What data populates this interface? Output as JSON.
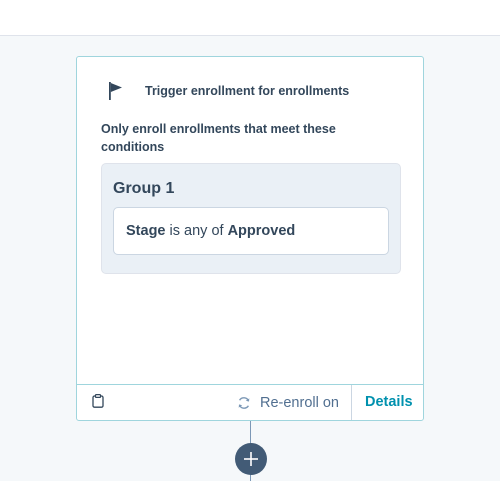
{
  "trigger_card": {
    "title": "Trigger enrollment for enrollments",
    "conditions_text": "Only enroll enrollments that meet these conditions",
    "group": {
      "title": "Group 1",
      "filter": {
        "property": "Stage",
        "operator": "is any of",
        "value": "Approved"
      }
    },
    "footer": {
      "reenroll_label": "Re-enroll on",
      "details_label": "Details"
    }
  },
  "icons": {
    "trigger": "flag-icon",
    "footer_left": "clipboard-icon",
    "reenroll": "refresh-icon",
    "add_action": "plus-icon"
  },
  "colors": {
    "accent": "#0091ae",
    "card_border": "#9fd5dd",
    "text": "#33475b",
    "add_button": "#425b76",
    "background": "#f5f8fa"
  }
}
